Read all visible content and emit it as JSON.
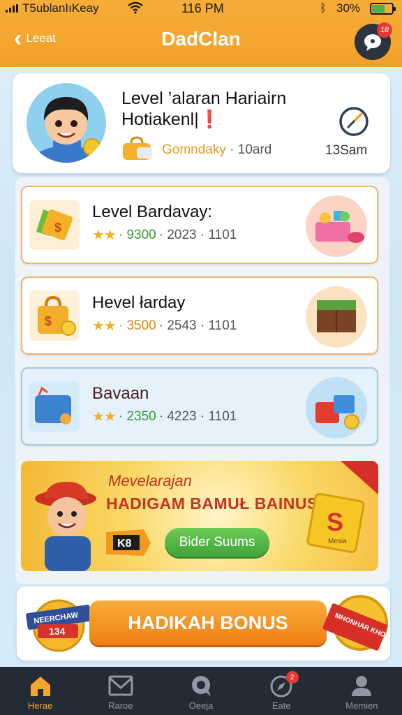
{
  "status_bar": {
    "carrier": "T5ublanIıKeay",
    "time": "116 PM",
    "battery": "30%"
  },
  "header": {
    "back_label": "Leeat",
    "title": "DadClan",
    "chat_badge": "18"
  },
  "profile": {
    "title": "Level ’alaran Hariairn",
    "subtitle": "Hotiakenl|❗",
    "meta_highlight": "Gomndaky",
    "meta_value": "· 10ard",
    "time_value": "13Sam"
  },
  "rewards": [
    {
      "title": "Level Bardavay:",
      "stars": "★★",
      "points": "· 9300",
      "details": "· 2023 · 1101",
      "style": "orange"
    },
    {
      "title": "Hevel łarday",
      "stars": "★★",
      "points": "· 3500",
      "details": "· 2543 · 1101",
      "style": "orange"
    },
    {
      "title": "Bavaan",
      "stars": "★★",
      "points": "· 2350",
      "details": "· 4223 · 1101",
      "style": "blue"
    }
  ],
  "promo": {
    "script_text": "Mevelarajan",
    "headline": "HADIGAM BAMUŁ BAINUS",
    "tag_text": "K8",
    "button_label": "Bider Suums",
    "cube_letter": "S",
    "cube_caption": "Mesia"
  },
  "bonus": {
    "badge_top": "NEERCHAW",
    "badge_num": "134",
    "button_label": "HADIKAH BONUS",
    "ribbon_text": "MHONHAR KHOUUAR"
  },
  "nav": {
    "items": [
      {
        "label": "Herae",
        "icon": "home-icon",
        "active": true
      },
      {
        "label": "Raroe",
        "icon": "mail-icon",
        "active": false
      },
      {
        "label": "Oeeja",
        "icon": "chat-icon",
        "active": false
      },
      {
        "label": "Eate",
        "icon": "compass-icon",
        "active": false,
        "badge": "2"
      },
      {
        "label": "Memien",
        "icon": "profile-icon",
        "active": false
      }
    ]
  },
  "colors": {
    "header": "#f1a12b",
    "accent_green": "#3fa23a",
    "nav_bg": "#252b36",
    "active_nav": "#f6a52d"
  }
}
